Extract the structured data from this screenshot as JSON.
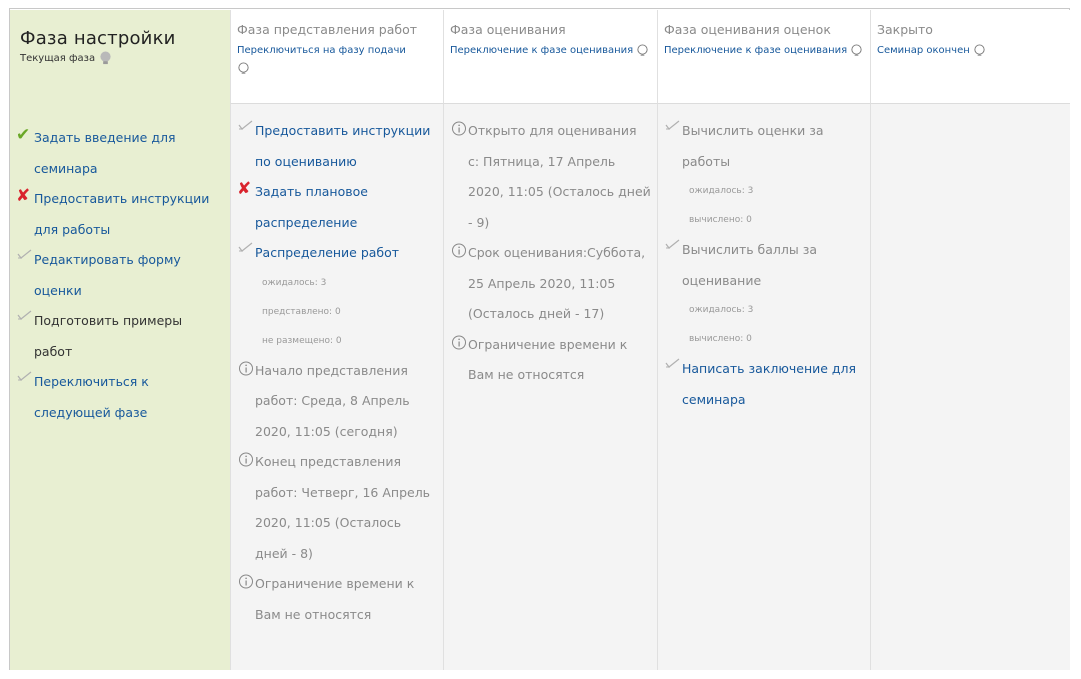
{
  "phases": [
    {
      "title": "Фаза настройки",
      "current_label": "Текущая фаза",
      "tasks": [
        {
          "status": "done",
          "text": "Задать введение для семинара"
        },
        {
          "status": "fail",
          "text": "Предоставить инструкции для работы"
        },
        {
          "status": "todo",
          "text": "Редактировать форму оценки"
        },
        {
          "status": "todo",
          "text": "Подготовить примеры работ"
        },
        {
          "status": "todo",
          "text": "Переключиться к следующей фазе"
        }
      ]
    },
    {
      "title": "Фаза представления работ",
      "switch_label": "Переключиться на фазу подачи",
      "tasks": [
        {
          "status": "todo",
          "text": "Предоставить инструкции по оцениванию"
        },
        {
          "status": "fail",
          "text": "Задать плановое распределение"
        },
        {
          "status": "todo",
          "text": "Распределение работ"
        }
      ],
      "details": [
        "ожидалось: 3",
        "представлено: 0",
        "не размещено: 0"
      ],
      "info": [
        "Начало представления работ: Среда, 8 Апрель 2020, 11:05 (сегодня)",
        "Конец представления работ: Четверг, 16 Апрель 2020, 11:05 (Осталось дней - 8)",
        "Ограничение времени к Вам не относятся"
      ]
    },
    {
      "title": "Фаза оценивания",
      "switch_label": "Переключение к фазе оценивания",
      "info": [
        "Открыто для оценивания с: Пятница, 17 Апрель 2020, 11:05 (Осталось дней - 9)",
        "Срок оценивания:Суббота, 25 Апрель 2020, 11:05 (Осталось дней - 17)",
        "Ограничение времени к Вам не относятся"
      ]
    },
    {
      "title": "Фаза оценивания оценок",
      "switch_label": "Переключение к фазе оценивания",
      "tasks": [
        {
          "status": "todo",
          "text": "Вычислить оценки за работы",
          "details": [
            "ожидалось: 3",
            "вычислено: 0"
          ]
        },
        {
          "status": "todo",
          "text": "Вычислить баллы за оценивание",
          "details": [
            "ожидалось: 3",
            "вычислено: 0"
          ]
        },
        {
          "status": "todo",
          "text": "Написать заключение для семинара",
          "details": []
        }
      ]
    },
    {
      "title": "Закрыто",
      "switch_label": "Семинар окончен"
    }
  ],
  "colors": {
    "active_bg": "#e8efd2",
    "link": "#17589b",
    "done": "#6aa827",
    "fail": "#d9232d"
  }
}
